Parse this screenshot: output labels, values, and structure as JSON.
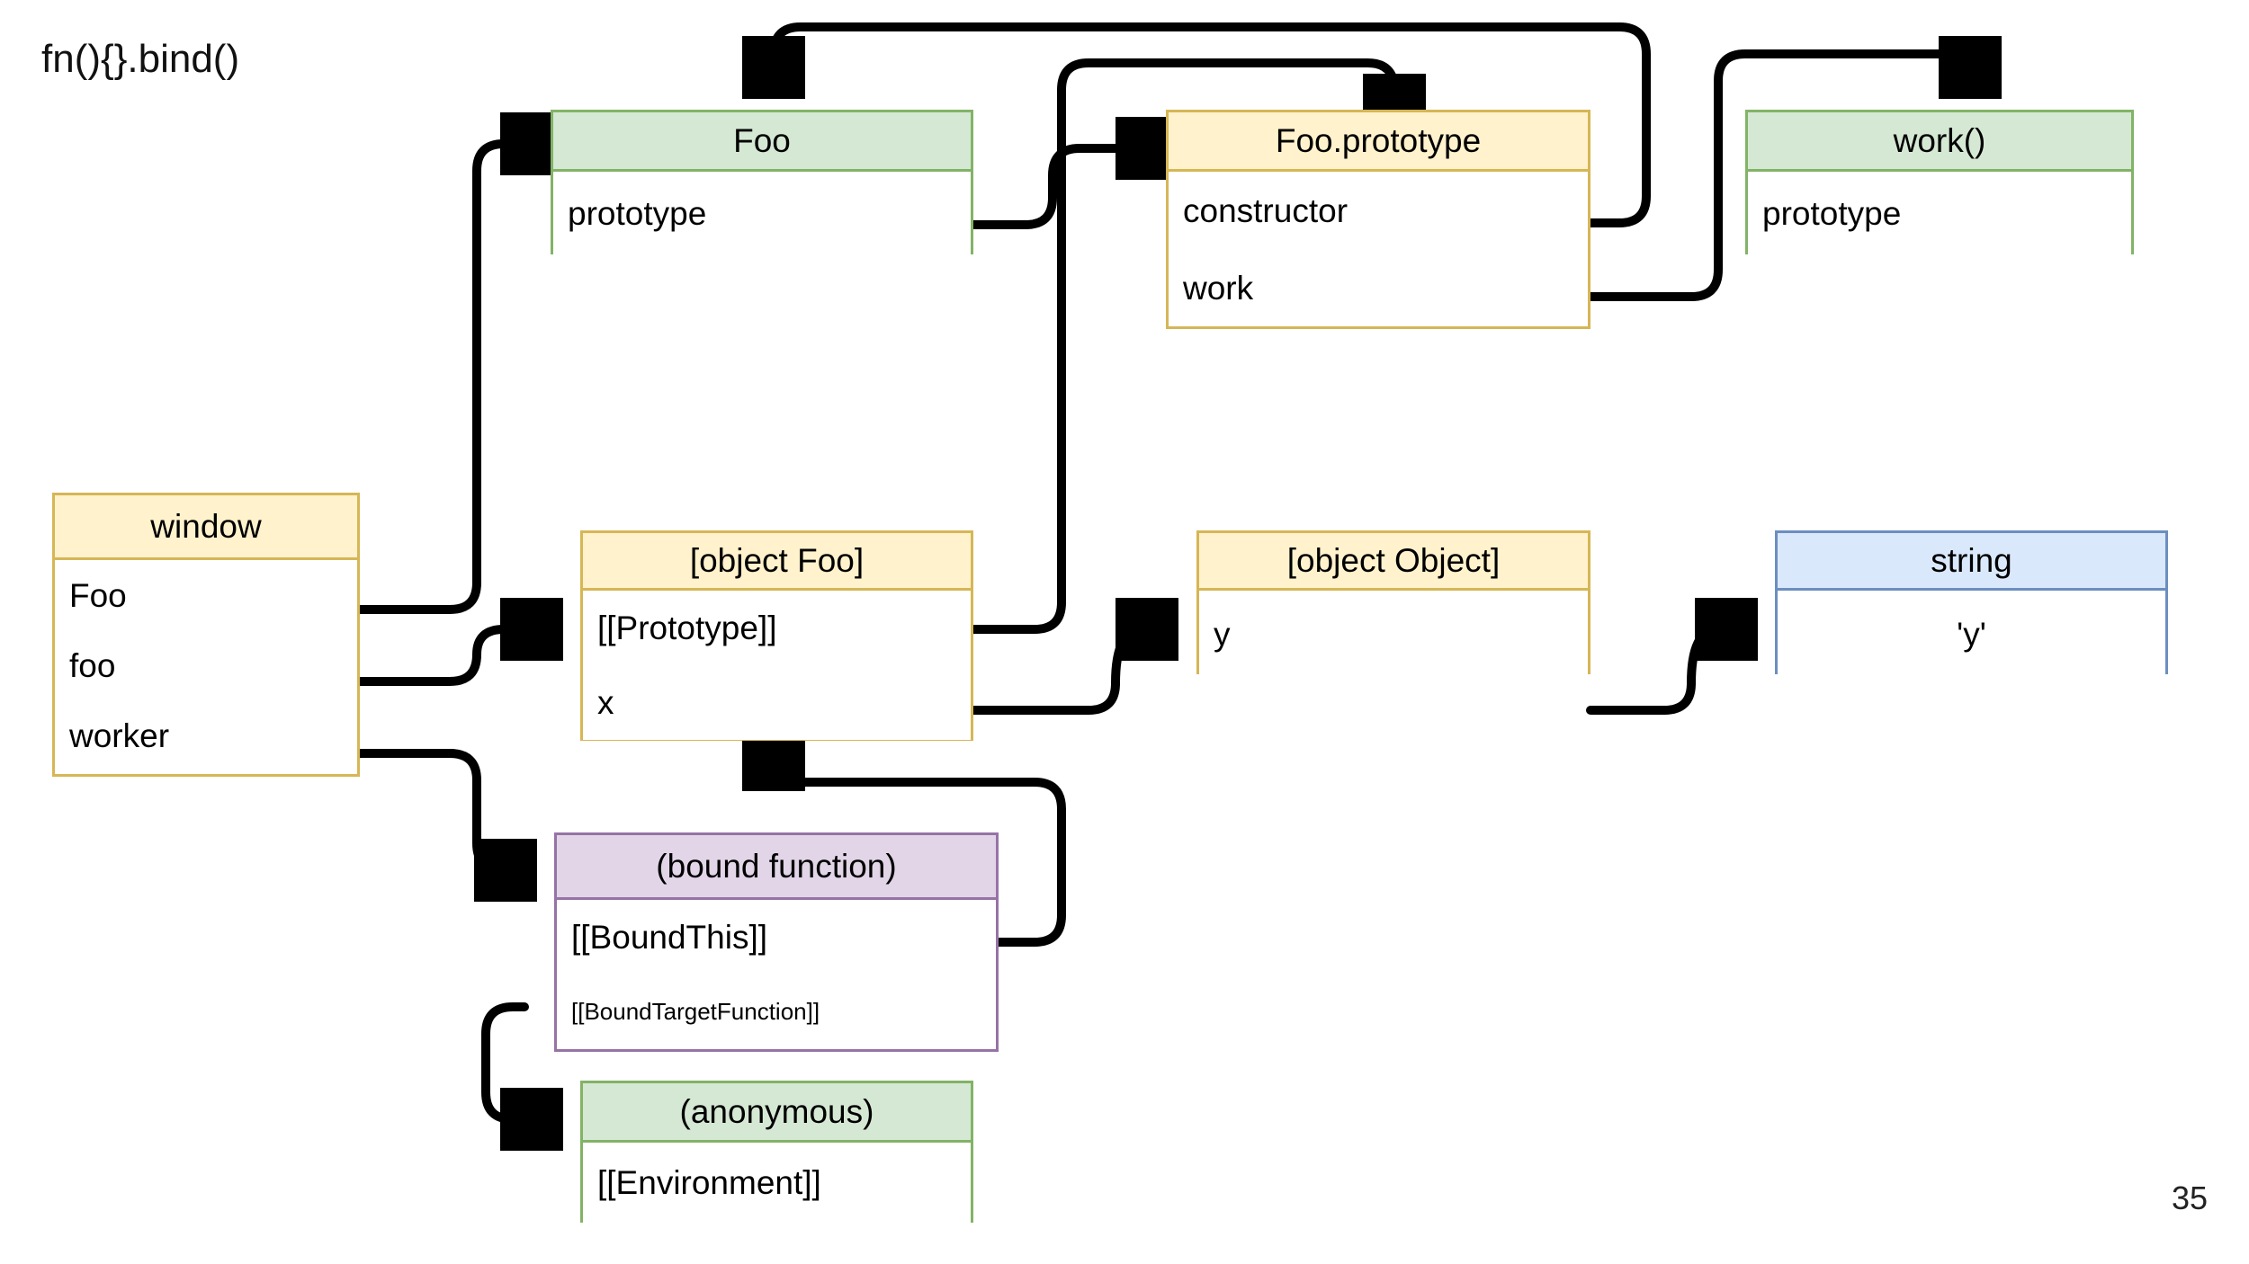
{
  "slide": {
    "title": "fn(){}.bind()",
    "page_number": "35",
    "background_color": "#ffffff"
  },
  "colors": {
    "green_fill": "#d5e8d4",
    "green_border": "#82b366",
    "yellow_fill": "#fff2cc",
    "yellow_border": "#d6b656",
    "purple_fill": "#e1d5e7",
    "purple_border": "#9673a6",
    "blue_fill": "#dae8fc",
    "blue_border": "#6c8ebf",
    "edge_color": "#000000"
  },
  "nodes": {
    "window": {
      "title": "window",
      "palette": "yellow",
      "rows": [
        "Foo",
        "foo",
        "worker"
      ]
    },
    "foo_ctor": {
      "title": "Foo",
      "palette": "green",
      "rows": [
        "prototype"
      ]
    },
    "foo_prototype": {
      "title": "Foo.prototype",
      "palette": "yellow",
      "rows": [
        "constructor",
        "work"
      ]
    },
    "work_fn": {
      "title": "work()",
      "palette": "green",
      "rows": [
        "prototype"
      ]
    },
    "object_foo": {
      "title": "[object Foo]",
      "palette": "yellow",
      "rows": [
        "[[Prototype]]",
        "x"
      ]
    },
    "object_object": {
      "title": "[object Object]",
      "palette": "yellow",
      "rows": [
        "y"
      ]
    },
    "string_node": {
      "title": "string",
      "palette": "blue",
      "rows": [
        "'y'"
      ]
    },
    "bound_function": {
      "title": "(bound function)",
      "palette": "purple",
      "rows": [
        "[[BoundThis]]",
        "[[BoundTargetFunction]]"
      ]
    },
    "anonymous": {
      "title": "(anonymous)",
      "palette": "green",
      "rows": [
        "[[Environment]]"
      ]
    }
  },
  "edges": [
    {
      "id": "window-Foo-to-Foo",
      "from": "window.Foo",
      "to": "foo_ctor.header"
    },
    {
      "id": "window-foo-to-objectFoo",
      "from": "window.foo",
      "to": "object_foo.header"
    },
    {
      "id": "window-worker-to-bound",
      "from": "window.worker",
      "to": "bound_function.header"
    },
    {
      "id": "Foo-prototype-to-FooPrototype",
      "from": "foo_ctor.prototype",
      "to": "foo_prototype.header-left"
    },
    {
      "id": "FooPrototype-constructor-to-Foo",
      "from": "foo_prototype.constructor",
      "to": "foo_ctor.header-top"
    },
    {
      "id": "FooPrototype-work-to-work",
      "from": "foo_prototype.work",
      "to": "work_fn.header-top"
    },
    {
      "id": "objectFoo-prototype-to-FooPrototype",
      "from": "object_foo.[[Prototype]]",
      "to": "foo_prototype.header-top"
    },
    {
      "id": "objectFoo-x-to-objectObject",
      "from": "object_foo.x",
      "to": "object_object.header"
    },
    {
      "id": "objectObject-y-to-string",
      "from": "object_object.y",
      "to": "string_node.header"
    },
    {
      "id": "bound-boundthis-to-objectFoo",
      "from": "bound_function.[[BoundThis]]",
      "to": "object_foo.bottom"
    },
    {
      "id": "bound-target-to-anonymous",
      "from": "bound_function.[[BoundTargetFunction]]",
      "to": "anonymous.header"
    }
  ]
}
